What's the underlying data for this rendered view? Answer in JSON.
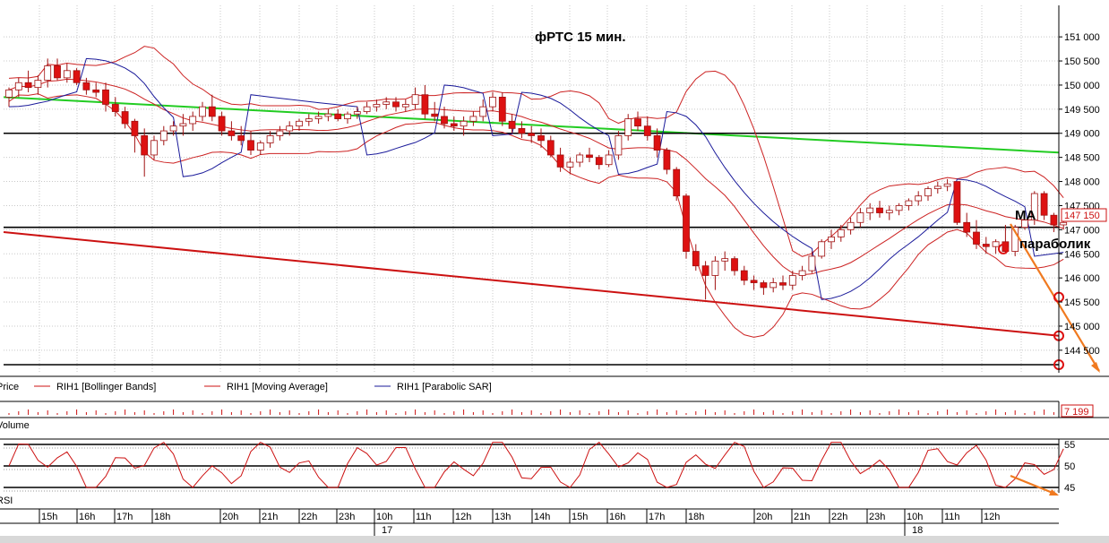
{
  "chart_data": {
    "type": "candlestick",
    "title": "фРТС   15 мин.",
    "price_axis": {
      "ticks": [
        "151 000",
        "150 500",
        "150 000",
        "149 500",
        "149 000",
        "148 500",
        "148 000",
        "147 500",
        "147 000",
        "146 500",
        "146 000",
        "145 500",
        "145 000",
        "144 500"
      ],
      "ylim": [
        144200,
        151300
      ],
      "current_price_label": "147 150"
    },
    "candles": [
      [
        149750,
        149950,
        149550,
        149900
      ],
      [
        149900,
        150150,
        149750,
        150050
      ],
      [
        150050,
        150300,
        149850,
        149950
      ],
      [
        149950,
        150200,
        149800,
        150100
      ],
      [
        150100,
        150550,
        149950,
        150400
      ],
      [
        150400,
        150550,
        150100,
        150150
      ],
      [
        150150,
        150450,
        150050,
        150300
      ],
      [
        150300,
        150350,
        150000,
        150050
      ],
      [
        150050,
        150150,
        149800,
        149900
      ],
      [
        149900,
        150050,
        149750,
        149850
      ],
      [
        149900,
        150050,
        149450,
        149600
      ],
      [
        149600,
        149750,
        149350,
        149450
      ],
      [
        149450,
        149550,
        149100,
        149200
      ],
      [
        149250,
        149300,
        148600,
        148950
      ],
      [
        148950,
        149100,
        148100,
        148550
      ],
      [
        148550,
        148950,
        148450,
        148850
      ],
      [
        148850,
        149150,
        148750,
        149050
      ],
      [
        149050,
        149250,
        148950,
        149150
      ],
      [
        149150,
        149400,
        148950,
        149200
      ],
      [
        149200,
        149450,
        149050,
        149350
      ],
      [
        149350,
        149650,
        149250,
        149550
      ],
      [
        149550,
        149800,
        149250,
        149350
      ],
      [
        149350,
        149450,
        148950,
        149050
      ],
      [
        149050,
        149250,
        148850,
        148950
      ],
      [
        148950,
        149150,
        148750,
        148850
      ],
      [
        148850,
        149050,
        148550,
        148650
      ],
      [
        148650,
        148850,
        148550,
        148800
      ],
      [
        148800,
        149050,
        148700,
        148950
      ],
      [
        148950,
        149150,
        148850,
        149050
      ],
      [
        149050,
        149250,
        148950,
        149150
      ],
      [
        149150,
        149300,
        149050,
        149250
      ],
      [
        149250,
        149400,
        149150,
        149300
      ],
      [
        149300,
        149450,
        149200,
        149350
      ],
      [
        149350,
        149500,
        149250,
        149400
      ],
      [
        149400,
        149500,
        149250,
        149300
      ],
      [
        149300,
        149450,
        149200,
        149400
      ],
      [
        149400,
        149550,
        149300,
        149450
      ],
      [
        149450,
        149650,
        149400,
        149550
      ],
      [
        149550,
        149700,
        149450,
        149600
      ],
      [
        149600,
        149750,
        149500,
        149650
      ],
      [
        149650,
        149750,
        149450,
        149550
      ],
      [
        149550,
        149700,
        149450,
        149600
      ],
      [
        149600,
        149950,
        149500,
        149800
      ],
      [
        149800,
        150000,
        149300,
        149400
      ],
      [
        149400,
        149650,
        149250,
        149350
      ],
      [
        149350,
        149550,
        149100,
        149200
      ],
      [
        149200,
        149350,
        149050,
        149150
      ],
      [
        149150,
        149350,
        148950,
        149250
      ],
      [
        149250,
        149450,
        149150,
        149350
      ],
      [
        149350,
        149700,
        149250,
        149550
      ],
      [
        149550,
        149850,
        149450,
        149750
      ],
      [
        149750,
        149850,
        149150,
        149250
      ],
      [
        149250,
        149400,
        149000,
        149100
      ],
      [
        149100,
        149250,
        148900,
        149000
      ],
      [
        149000,
        149150,
        148800,
        148950
      ],
      [
        148950,
        149100,
        148700,
        148850
      ],
      [
        148850,
        148950,
        148500,
        148550
      ],
      [
        148550,
        148700,
        148200,
        148300
      ],
      [
        148300,
        148500,
        148150,
        148400
      ],
      [
        148400,
        148600,
        148300,
        148550
      ],
      [
        148550,
        148700,
        148400,
        148500
      ],
      [
        148500,
        148550,
        148250,
        148350
      ],
      [
        148350,
        148650,
        148300,
        148550
      ],
      [
        148550,
        149050,
        148450,
        148950
      ],
      [
        148950,
        149400,
        148850,
        149300
      ],
      [
        149300,
        149450,
        149050,
        149150
      ],
      [
        149150,
        149350,
        148850,
        148950
      ],
      [
        148950,
        149100,
        148500,
        148650
      ],
      [
        148650,
        148700,
        148150,
        148250
      ],
      [
        148250,
        148300,
        147600,
        147700
      ],
      [
        147700,
        147750,
        146400,
        146550
      ],
      [
        146550,
        146700,
        146150,
        146250
      ],
      [
        146250,
        146350,
        145550,
        146050
      ],
      [
        146050,
        146450,
        145750,
        146350
      ],
      [
        146350,
        146550,
        146150,
        146400
      ],
      [
        146400,
        146450,
        146050,
        146150
      ],
      [
        146150,
        146250,
        145850,
        145950
      ],
      [
        145950,
        146050,
        145750,
        145900
      ],
      [
        145900,
        145950,
        145650,
        145800
      ],
      [
        145800,
        146000,
        145700,
        145900
      ],
      [
        145900,
        146050,
        145750,
        145850
      ],
      [
        145850,
        146150,
        145750,
        146050
      ],
      [
        146050,
        146250,
        145950,
        146150
      ],
      [
        146150,
        146550,
        146100,
        146450
      ],
      [
        146450,
        146800,
        146400,
        146750
      ],
      [
        146750,
        147000,
        146600,
        146850
      ],
      [
        146850,
        147100,
        146750,
        147000
      ],
      [
        147000,
        147250,
        146900,
        147150
      ],
      [
        147150,
        147450,
        147050,
        147350
      ],
      [
        147350,
        147550,
        147200,
        147450
      ],
      [
        147450,
        147600,
        147250,
        147350
      ],
      [
        147350,
        147500,
        147200,
        147400
      ],
      [
        147400,
        147550,
        147300,
        147500
      ],
      [
        147500,
        147650,
        147400,
        147600
      ],
      [
        147600,
        147800,
        147500,
        147700
      ],
      [
        147700,
        147900,
        147600,
        147850
      ],
      [
        147850,
        148000,
        147750,
        147900
      ],
      [
        147900,
        148050,
        147800,
        147950
      ],
      [
        148000,
        148000,
        147100,
        147150
      ],
      [
        147150,
        147350,
        146850,
        146950
      ],
      [
        146950,
        147200,
        146600,
        146700
      ],
      [
        146700,
        146850,
        146500,
        146650
      ],
      [
        146650,
        146800,
        146500,
        146750
      ],
      [
        146750,
        147100,
        146500,
        146550
      ],
      [
        146550,
        147100,
        146450,
        147050
      ],
      [
        147050,
        147300,
        147000,
        147200
      ],
      [
        147200,
        147800,
        147100,
        147750
      ],
      [
        147750,
        147800,
        147200,
        147300
      ],
      [
        147300,
        147350,
        146950,
        147100
      ],
      [
        147100,
        147250,
        147000,
        147150
      ]
    ],
    "overlay_lines": [
      {
        "name": "green trendline",
        "color": "#22cc22",
        "from": [
          149750,
          150850
        ],
        "to_end": 148600
      },
      {
        "name": "red trendline",
        "color": "#cc1111",
        "from": [
          146950,
          146950
        ],
        "to_end": 144800
      },
      {
        "name": "level 149000",
        "color": "#000000",
        "value": 149000
      },
      {
        "name": "level 147050",
        "color": "#000000",
        "value": 147050
      },
      {
        "name": "level 144200",
        "color": "#000000",
        "value": 144200
      }
    ],
    "annotations": [
      {
        "text": "MA",
        "value": 147100
      },
      {
        "text": "параболик",
        "value": 146650
      }
    ],
    "legend": [
      {
        "label": "Price",
        "color": "#cc1111"
      },
      {
        "label": "RIH1 [Bollinger Bands]",
        "color": "#cc1111"
      },
      {
        "label": "RIH1 [Moving Average]",
        "color": "#cc1111"
      },
      {
        "label": "RIH1 [Parabolic SAR]",
        "color": "#1a1a9a"
      }
    ],
    "volume_panel": {
      "label": "Volume",
      "value_label": "7 199"
    },
    "rsi_panel": {
      "label": "RSI",
      "ticks": [
        "55",
        "50",
        "45"
      ],
      "ylim": [
        44,
        56
      ]
    },
    "time_axis": {
      "ticks": [
        "15h",
        "16h",
        "17h",
        "18h",
        "20h",
        "21h",
        "22h",
        "23h",
        "10h",
        "11h",
        "12h",
        "13h",
        "14h",
        "15h",
        "16h",
        "17h",
        "18h",
        "20h",
        "21h",
        "22h",
        "23h",
        "10h",
        "11h",
        "12h"
      ],
      "day_labels": [
        "17",
        "18"
      ]
    }
  },
  "colors": {
    "bear": "#dd1111",
    "bull": "#ffffff",
    "band": "#cc2222",
    "sar": "#1a1a9a",
    "forecast": "#f07a20"
  }
}
